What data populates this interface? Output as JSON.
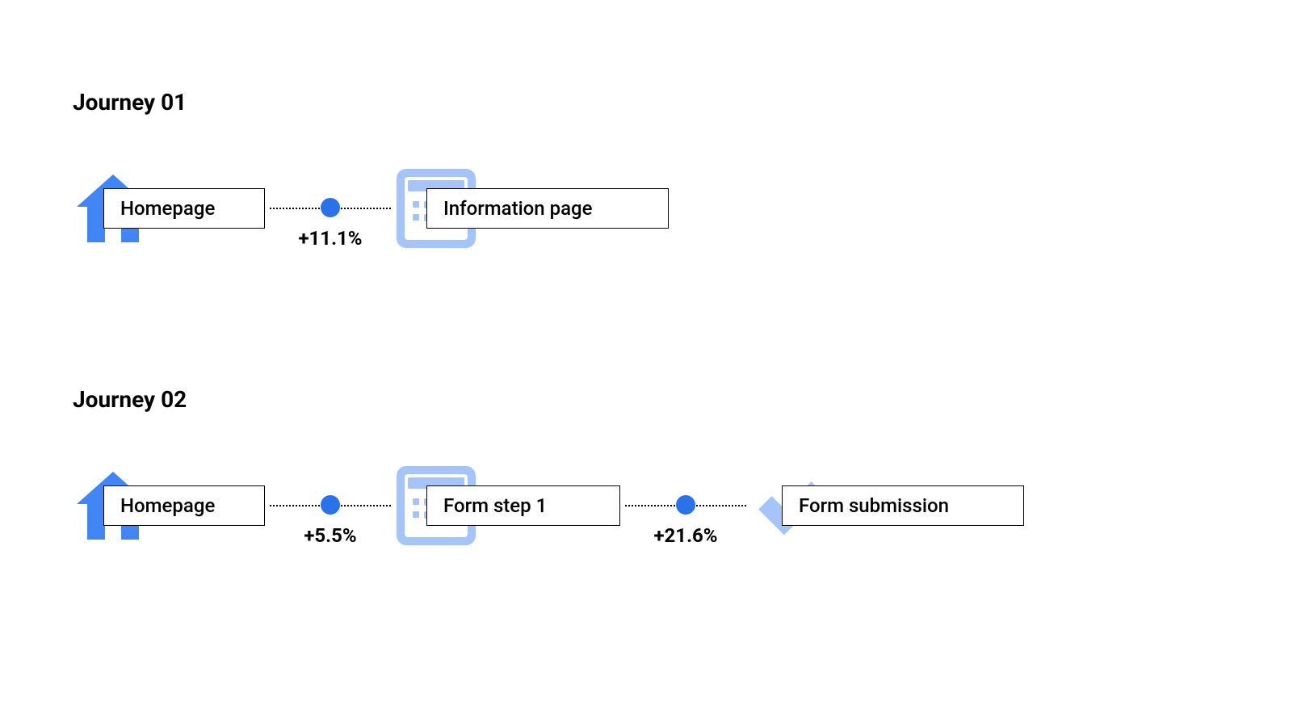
{
  "journeys": [
    {
      "title": "Journey 01",
      "steps": [
        {
          "icon": "home",
          "label": "Homepage"
        },
        {
          "icon": "doc",
          "label": "Information page"
        }
      ],
      "connectors": [
        {
          "pct": "+11.1%"
        }
      ]
    },
    {
      "title": "Journey 02",
      "steps": [
        {
          "icon": "home",
          "label": "Homepage"
        },
        {
          "icon": "doc",
          "label": "Form step 1"
        },
        {
          "icon": "check",
          "label": "Form submission"
        }
      ],
      "connectors": [
        {
          "pct": "+5.5%"
        },
        {
          "pct": "+21.6%"
        }
      ]
    }
  ],
  "colors": {
    "primary": "#4285f4",
    "dot": "#2a72e8",
    "lightblue": "#a5c5fa"
  }
}
